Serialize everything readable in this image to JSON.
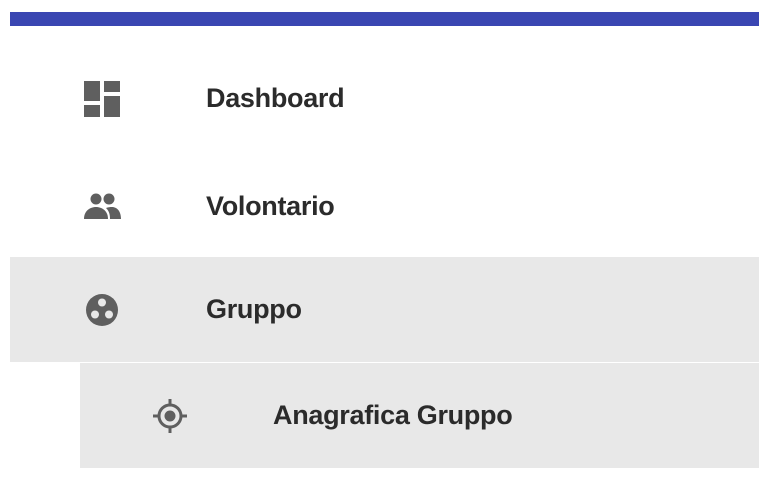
{
  "header": {
    "bar_color": "#3a46b2"
  },
  "sidebar": {
    "items": [
      {
        "label": "Dashboard",
        "icon": "dashboard-icon"
      },
      {
        "label": "Volontario",
        "icon": "people-icon"
      },
      {
        "label": "Gruppo",
        "icon": "group-workspaces-icon",
        "active": true
      },
      {
        "label": "Anagrafica Gruppo",
        "icon": "target-icon",
        "submenu": true
      }
    ],
    "active_background": "#e8e8e8",
    "icon_color": "#5f5f5f"
  }
}
